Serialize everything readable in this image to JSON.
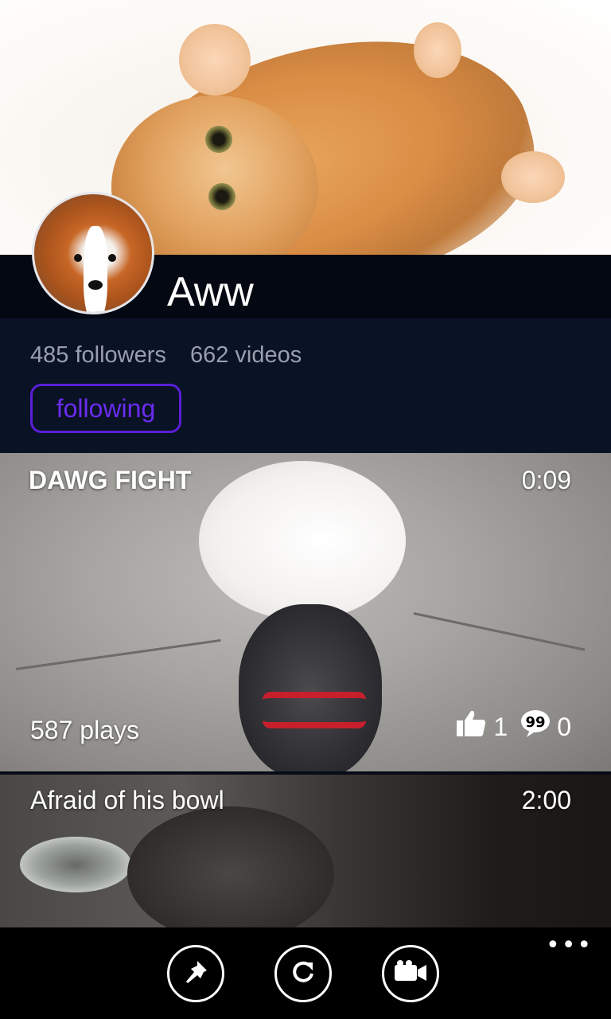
{
  "channel": {
    "name": "Aww",
    "followers": "485 followers",
    "videos_count": "662 videos",
    "follow_button": "following"
  },
  "videos": [
    {
      "title": "DAWG FIGHT",
      "duration": "0:09",
      "plays": "587 plays",
      "likes": "1",
      "comments": "0"
    },
    {
      "title": "Afraid of his bowl",
      "duration": "2:00"
    }
  ],
  "appbar": {
    "buttons": [
      "pin-icon",
      "refresh-icon",
      "video-camera-icon"
    ],
    "more": "•••"
  },
  "colors": {
    "accent": "#5a1fd6",
    "header_bg": "#040812",
    "panel_bg": "#0a1226"
  }
}
